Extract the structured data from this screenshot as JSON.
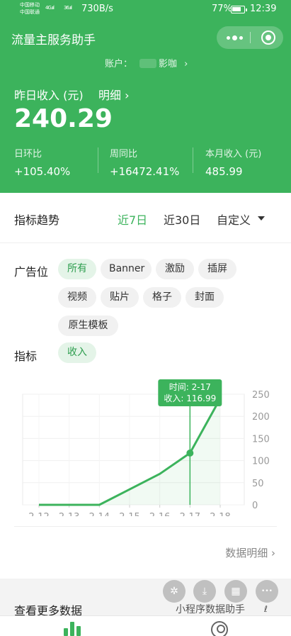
{
  "status_bar": {
    "carrier_1": "中国移动",
    "carrier_2": "中国联通",
    "signal_1": "4G.ııl",
    "signal_2": "36.ııl",
    "net_speed": "730B/s",
    "battery_percent": "77%",
    "battery_level": 0.77,
    "time": "12:39"
  },
  "app_bar": {
    "title": "流量主服务助手",
    "more_icon": "more-dots-icon",
    "close_icon": "target-circle-icon"
  },
  "account": {
    "label": "账户：",
    "name": "影咖",
    "arrow": "›"
  },
  "summary": {
    "label": "昨日收入 (元)",
    "detail_link": "明细 ›",
    "value": "240.29",
    "stats": [
      {
        "label": "日环比",
        "value": "+105.40%"
      },
      {
        "label": "周同比",
        "value": "+16472.41%"
      },
      {
        "label": "本月收入 (元)",
        "value": "485.99"
      }
    ]
  },
  "trend": {
    "title": "指标趋势",
    "ranges": [
      "近7日",
      "近30日",
      "自定义"
    ],
    "active_range": "近7日"
  },
  "filters": {
    "slot_label": "广告位",
    "slots": [
      "所有",
      "Banner",
      "激励",
      "插屏",
      "视频",
      "贴片",
      "格子",
      "封面",
      "原生模板"
    ],
    "active_slot": "所有",
    "metric_label": "指标",
    "metrics": [
      "收入"
    ],
    "active_metric": "收入"
  },
  "chart_data": {
    "type": "line",
    "categories": [
      "2-12",
      "2-13",
      "2-14",
      "2-15",
      "2-16",
      "2-17",
      "2-18"
    ],
    "series": [
      {
        "values": [
          0,
          0,
          0,
          35,
          70,
          116.99,
          240.29
        ]
      }
    ],
    "ylim": [
      0,
      250
    ],
    "y_ticks": [
      "0",
      "50",
      "100",
      "150",
      "200",
      "250"
    ],
    "grid": true,
    "y_axis_side": "right",
    "line_color": "#3cb35c",
    "tooltip": {
      "category": "2-17",
      "time_text": "时间: 2-17",
      "value_text": "收入: 116.99"
    }
  },
  "data_detail_link": "数据明细  ›",
  "more_data": {
    "title": "查看更多数据",
    "brand": "小程序数据助手",
    "link_icon": "ℓ"
  },
  "float_buttons": [
    {
      "icon": "pinwheel-icon",
      "glyph": "✲"
    },
    {
      "icon": "download-icon",
      "glyph": "⤓"
    },
    {
      "icon": "grid-icon",
      "glyph": "▦"
    },
    {
      "icon": "more-icon",
      "glyph": "•••"
    }
  ],
  "tab_bar": {
    "tabs": [
      {
        "icon": "bar-chart-icon",
        "active": true
      },
      {
        "icon": "user-icon",
        "active": false
      }
    ]
  },
  "colors": {
    "brand_green": "#3cb35c",
    "chip_active_bg": "#e4f4e8",
    "chip_bg": "#f1f1f1"
  }
}
